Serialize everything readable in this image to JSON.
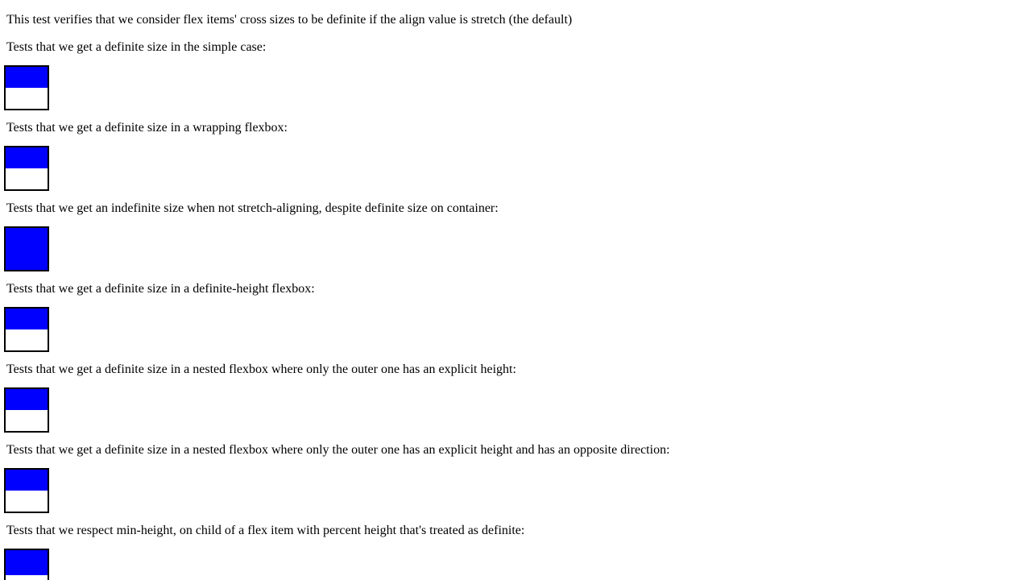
{
  "intro": "This test verifies that we consider flex items' cross sizes to be definite if the align value is stretch (the default)",
  "tests": [
    {
      "label": "Tests that we get a definite size in the simple case:",
      "fill_fraction": 0.5
    },
    {
      "label": "Tests that we get a definite size in a wrapping flexbox:",
      "fill_fraction": 0.5
    },
    {
      "label": "Tests that we get an indefinite size when not stretch-aligning, despite definite size on container:",
      "fill_fraction": 1.0
    },
    {
      "label": "Tests that we get a definite size in a definite-height flexbox:",
      "fill_fraction": 0.5
    },
    {
      "label": "Tests that we get a definite size in a nested flexbox where only the outer one has an explicit height:",
      "fill_fraction": 0.5
    },
    {
      "label": "Tests that we get a definite size in a nested flexbox where only the outer one has an explicit height and has an opposite direction:",
      "fill_fraction": 0.5
    },
    {
      "label": "Tests that we respect min-height, on child of a flex item with percent height that's treated as definite:",
      "fill_fraction": 0.6
    }
  ],
  "colors": {
    "fill": "#0000ff",
    "border": "#000000",
    "background": "#ffffff"
  }
}
